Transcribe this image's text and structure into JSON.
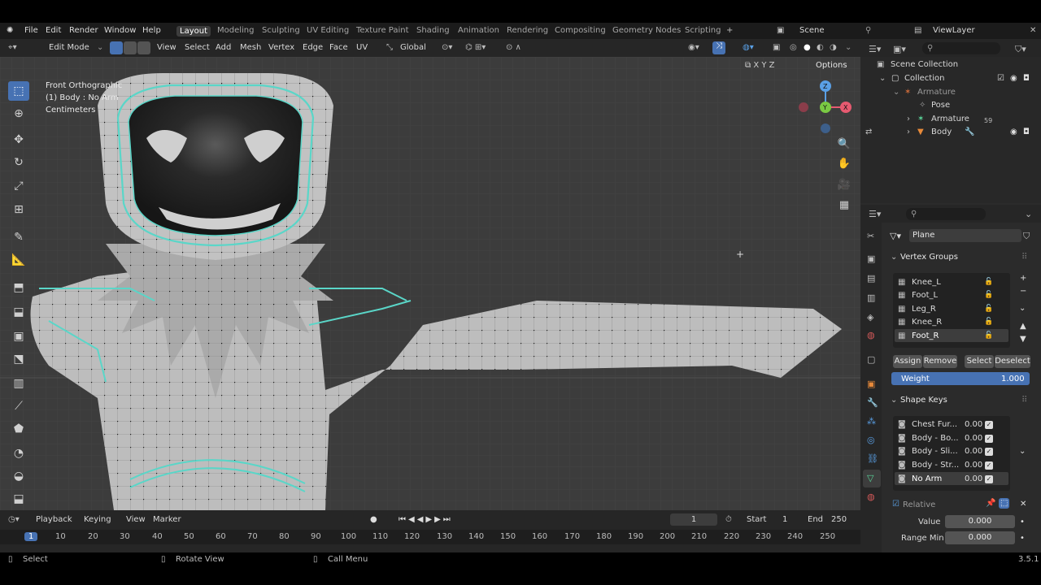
{
  "menu": {
    "items": [
      "File",
      "Edit",
      "Render",
      "Window",
      "Help"
    ]
  },
  "workspaces": [
    "Layout",
    "Modeling",
    "Sculpting",
    "UV Editing",
    "Texture Paint",
    "Shading",
    "Animation",
    "Rendering",
    "Compositing",
    "Geometry Nodes",
    "Scripting"
  ],
  "scene": {
    "name": "Scene",
    "view_layer": "ViewLayer"
  },
  "header": {
    "mode": "Edit Mode",
    "menus": [
      "View",
      "Select",
      "Add",
      "Mesh",
      "Vertex",
      "Edge",
      "Face",
      "UV"
    ],
    "transform": "Global",
    "options": "Options",
    "axes": [
      "X",
      "Y",
      "Z"
    ]
  },
  "viewport": {
    "view_name": "Front Orthographic",
    "object_info": "(1) Body : No Arm",
    "units": "Centimeters"
  },
  "outliner": {
    "root": "Scene Collection",
    "collection": "Collection",
    "items": [
      "Armature",
      "Pose",
      "Armature",
      "Body"
    ],
    "badge": "59"
  },
  "properties": {
    "object": "Plane",
    "vertex_groups_title": "Vertex Groups",
    "vertex_groups": [
      "Knee_L",
      "Foot_L",
      "Leg_R",
      "Knee_R",
      "Foot_R"
    ],
    "buttons": [
      "Assign",
      "Remove",
      "Select",
      "Deselect"
    ],
    "weight_label": "Weight",
    "weight_value": "1.000",
    "shape_keys_title": "Shape Keys",
    "shape_keys": [
      {
        "name": "Chest Fur...",
        "value": "0.00"
      },
      {
        "name": "Body - Bo...",
        "value": "0.00"
      },
      {
        "name": "Body - Sli...",
        "value": "0.00"
      },
      {
        "name": "Body - Str...",
        "value": "0.00"
      },
      {
        "name": "No Arm",
        "value": "0.00"
      }
    ],
    "relative_label": "Relative",
    "value_label": "Value",
    "value": "0.000",
    "range_min_label": "Range Min",
    "range_min": "0.000"
  },
  "timeline": {
    "menus": [
      "Playback",
      "Keying",
      "View",
      "Marker"
    ],
    "current_frame": "1",
    "start_label": "Start",
    "start": "1",
    "end_label": "End",
    "end": "250",
    "ticks": [
      "1",
      "10",
      "20",
      "30",
      "40",
      "50",
      "60",
      "70",
      "80",
      "90",
      "100",
      "110",
      "120",
      "130",
      "140",
      "150",
      "160",
      "170",
      "180",
      "190",
      "200",
      "210",
      "220",
      "230",
      "240",
      "250"
    ]
  },
  "status": {
    "select": "Select",
    "rotate": "Rotate View",
    "menu": "Call Menu",
    "version": "3.5.1"
  },
  "colors": {
    "accent": "#4772b3",
    "highlight": "#5ad6c8",
    "viewport": "#3c3c3c"
  }
}
